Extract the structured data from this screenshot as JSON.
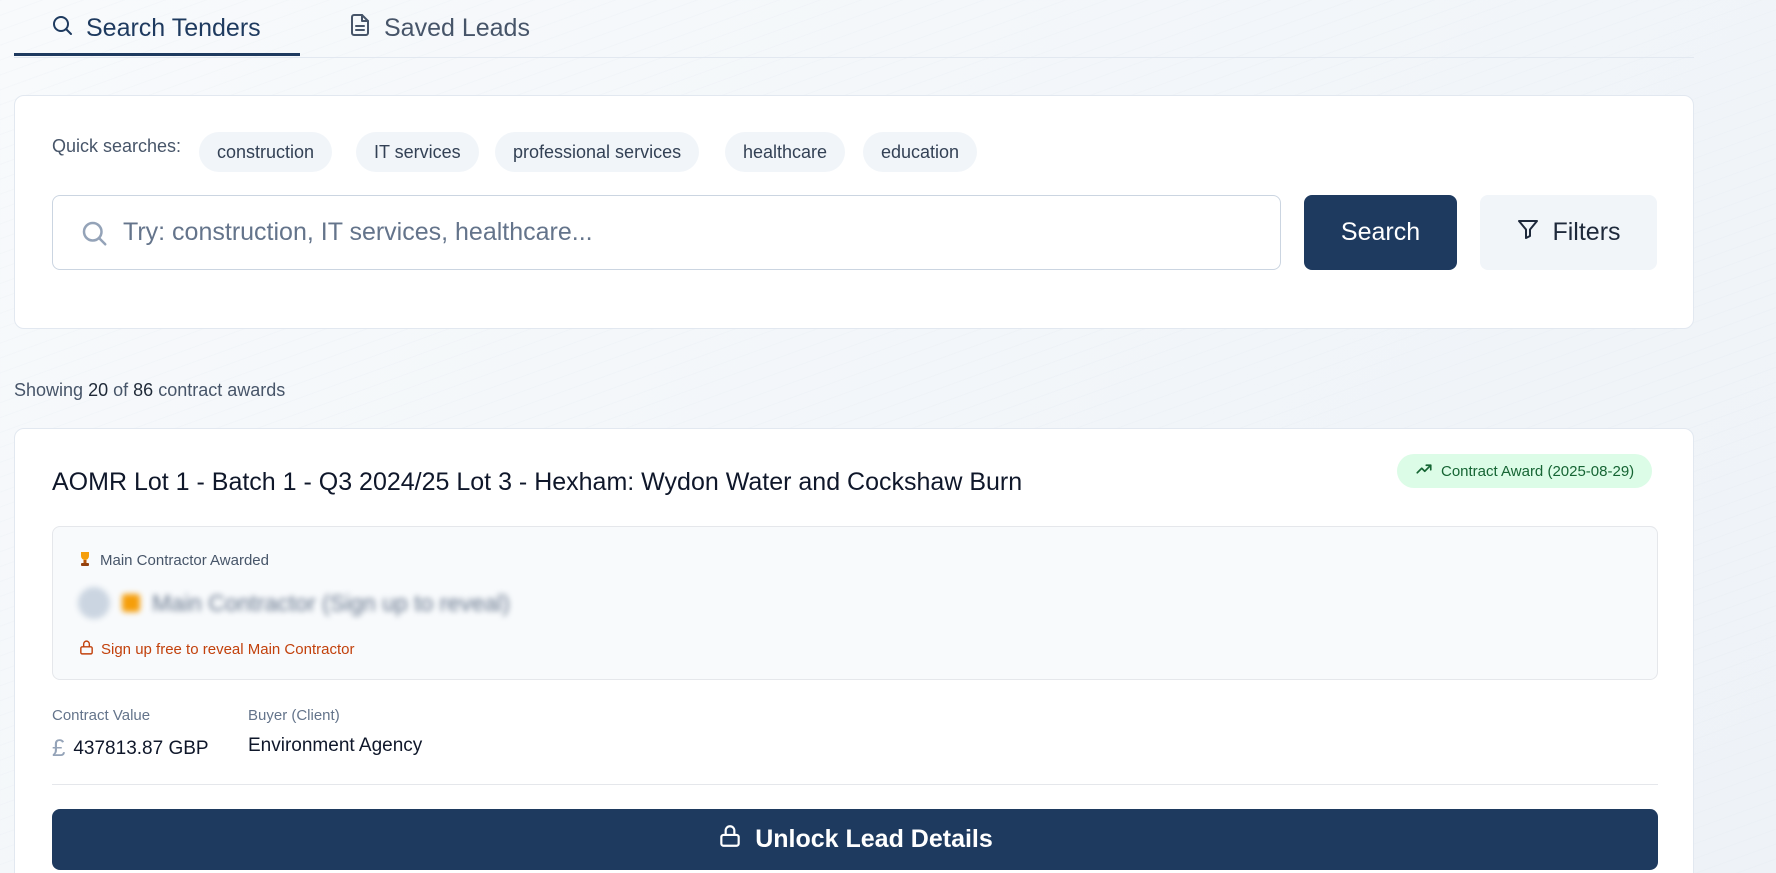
{
  "tabs": [
    {
      "label": "Search Tenders",
      "icon": "search-icon",
      "active": true
    },
    {
      "label": "Saved Leads",
      "icon": "document-icon",
      "active": false
    }
  ],
  "search": {
    "quick_label": "Quick searches:",
    "quick_chips": [
      "construction",
      "IT services",
      "professional services",
      "healthcare",
      "education"
    ],
    "placeholder": "Try: construction, IT services, healthcare...",
    "value": "",
    "search_button": "Search",
    "filters_button": "Filters"
  },
  "results": {
    "prefix": "Showing",
    "shown": "20",
    "of": "of",
    "total": "86",
    "suffix": "contract awards"
  },
  "card": {
    "title": "AOMR Lot 1 - Batch 1 - Q3 2024/25 Lot 3 - Hexham: Wydon Water and Cockshaw Burn",
    "badge": "Contract Award (2025-08-29)",
    "contractor_heading": "Main Contractor Awarded",
    "contractor_blurred": "Main Contractor (Sign up to reveal)",
    "reveal_link": "Sign up free to reveal Main Contractor",
    "value_label": "Contract Value",
    "value_symbol": "£",
    "value": "437813.87 GBP",
    "buyer_label": "Buyer (Client)",
    "buyer": "Environment Agency",
    "unlock_button": "Unlock Lead Details"
  },
  "colors": {
    "primary": "#1e3a5f",
    "badge_bg": "#dcfce7",
    "badge_text": "#166534",
    "reveal_link": "#c2410c"
  }
}
